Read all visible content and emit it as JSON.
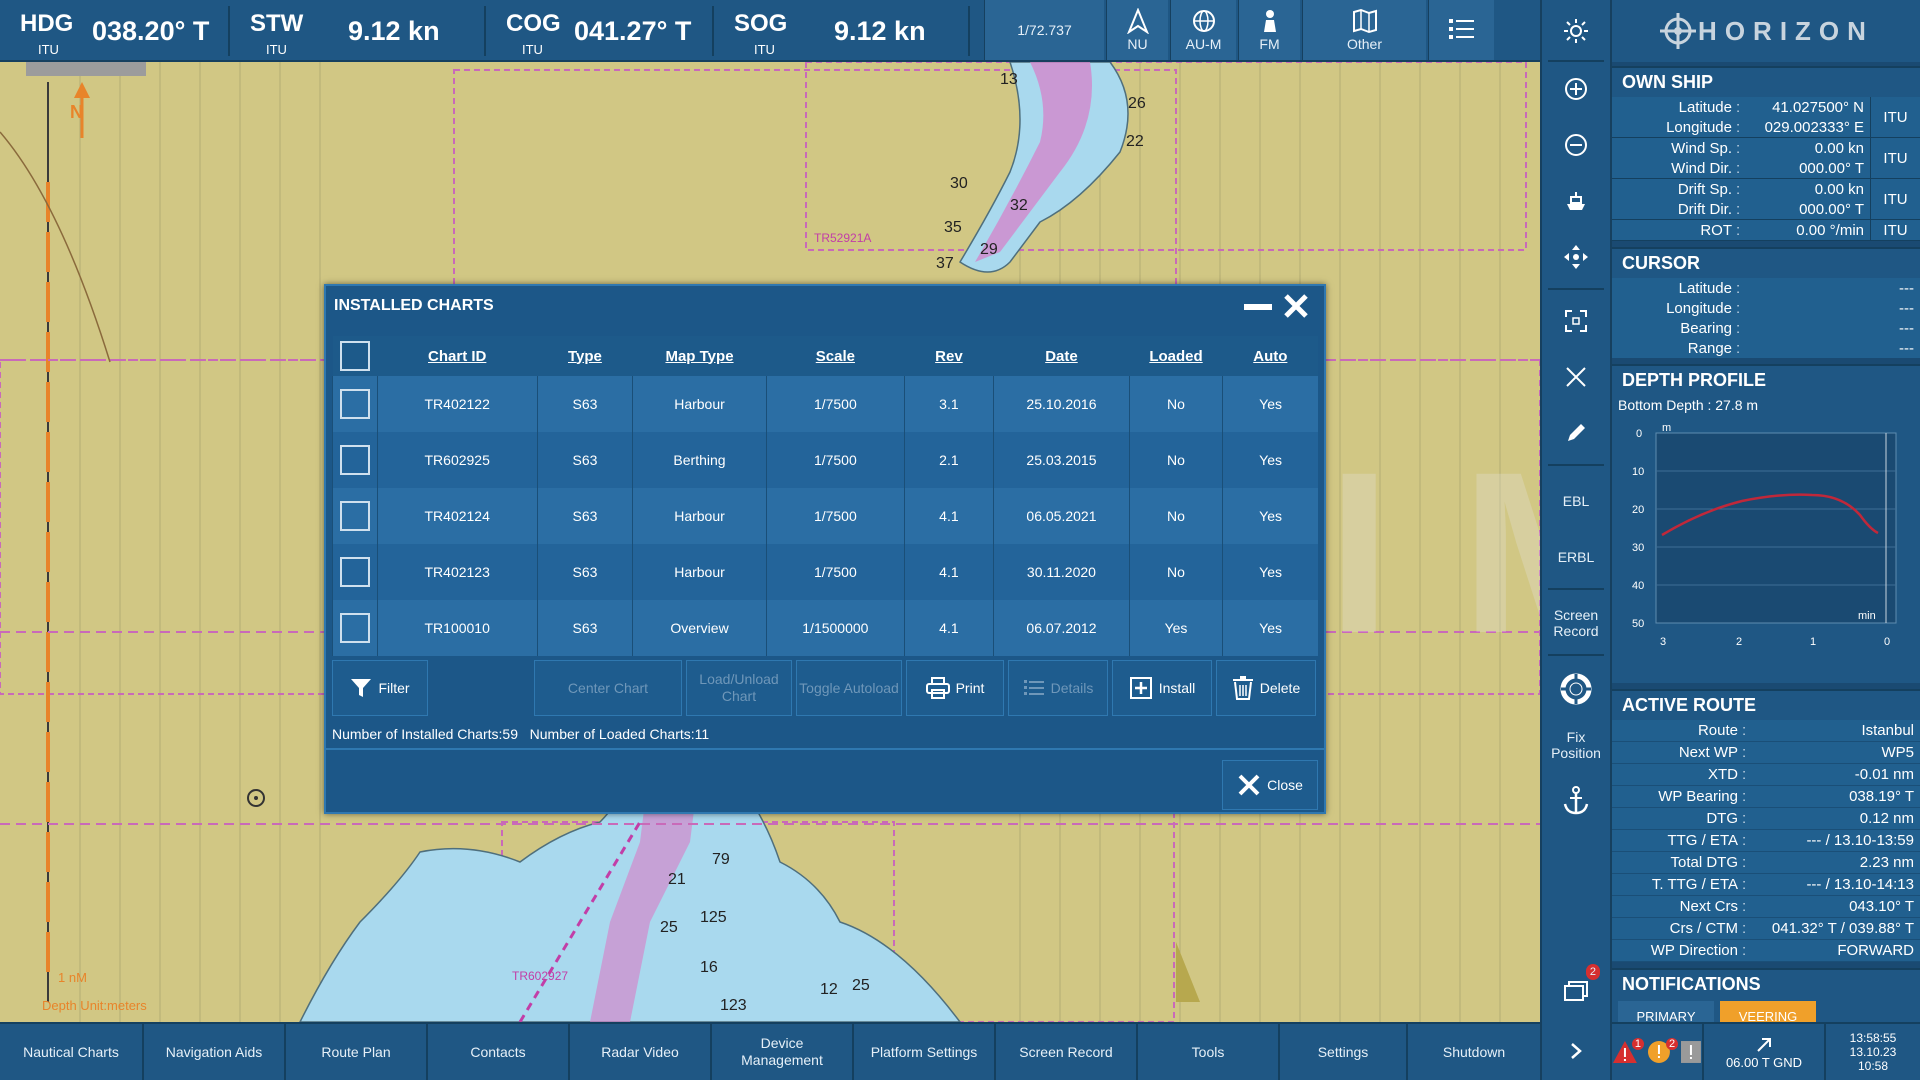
{
  "topbar": {
    "hdg": {
      "label": "HDG",
      "value": "038.20° T",
      "source": "ITU"
    },
    "stw": {
      "label": "STW",
      "value": "9.12 kn",
      "source": "ITU"
    },
    "cog": {
      "label": "COG",
      "value": "041.27° T",
      "source": "ITU"
    },
    "sog": {
      "label": "SOG",
      "value": "9.12 kn",
      "source": "ITU"
    },
    "scale": "1/72.737",
    "nu_label": "NU",
    "aum_label": "AU-M",
    "fm_label": "FM",
    "other_label": "Other"
  },
  "map": {
    "north_label": "N",
    "scale_bar": "1 nM",
    "depth_unit": "Depth Unit:meters",
    "labels": {
      "tr529": "TR52921A",
      "tr602": "TR602927"
    },
    "soundings": [
      "13",
      "26",
      "22",
      "30",
      "32",
      "35",
      "37",
      "29",
      "125",
      "79",
      "25",
      "21",
      "16",
      "25",
      "12",
      "123"
    ]
  },
  "watermark": "MARSIM",
  "tools": {
    "ebl": "EBL",
    "erbl": "ERBL",
    "screen_record": "Screen Record",
    "fix_position": "Fix Position",
    "notif_count": "2"
  },
  "brand": "HORIZON",
  "own_ship": {
    "title": "OWN SHIP",
    "latitude": {
      "label": "Latitude",
      "value": "41.027500° N"
    },
    "longitude": {
      "label": "Longitude",
      "value": "029.002333° E"
    },
    "pos_src": "ITU",
    "wind_sp": {
      "label": "Wind Sp.",
      "value": "0.00 kn"
    },
    "wind_dir": {
      "label": "Wind Dir.",
      "value": "000.00° T"
    },
    "wind_src": "ITU",
    "drift_sp": {
      "label": "Drift Sp.",
      "value": "0.00 kn"
    },
    "drift_dir": {
      "label": "Drift Dir.",
      "value": "000.00° T"
    },
    "drift_src": "ITU",
    "rot": {
      "label": "ROT",
      "value": "0.00 °/min"
    },
    "rot_src": "ITU"
  },
  "cursor": {
    "title": "CURSOR",
    "latitude": {
      "label": "Latitude",
      "value": "---"
    },
    "longitude": {
      "label": "Longitude",
      "value": "---"
    },
    "bearing": {
      "label": "Bearing",
      "value": "---"
    },
    "range": {
      "label": "Range",
      "value": "---"
    }
  },
  "depth_profile": {
    "title": "DEPTH PROFILE",
    "bottom_depth": "Bottom Depth : 27.8 m",
    "unit_y": "m",
    "unit_x": "min",
    "y_ticks": [
      "0",
      "10",
      "20",
      "30",
      "40",
      "50"
    ],
    "x_ticks": [
      "3",
      "2",
      "1",
      "0"
    ]
  },
  "active_route": {
    "title": "ACTIVE ROUTE",
    "rows": [
      {
        "label": "Route",
        "value": "Istanbul"
      },
      {
        "label": "Next WP",
        "value": "WP5"
      },
      {
        "label": "XTD",
        "value": "-0.01 nm"
      },
      {
        "label": "WP Bearing",
        "value": "038.19° T"
      },
      {
        "label": "DTG",
        "value": "0.12 nm"
      },
      {
        "label": "TTG / ETA",
        "value": "--- / 13.10-13:59"
      },
      {
        "label": "Total DTG",
        "value": "2.23 nm"
      },
      {
        "label": "T. TTG / ETA",
        "value": "--- / 13.10-14:13"
      },
      {
        "label": "Next Crs",
        "value": "043.10° T"
      },
      {
        "label": "Crs / CTM",
        "value": "041.32° T / 039.88° T"
      },
      {
        "label": "WP Direction",
        "value": "FORWARD"
      }
    ]
  },
  "notifications": {
    "title": "NOTIFICATIONS",
    "tab_primary": "PRIMARY",
    "tab_veering": "VEERING",
    "alarm_count": "1",
    "warning_count": "2"
  },
  "status": {
    "wind": "06.00 T GND",
    "time": "13:58:55",
    "date": "13.10.23",
    "time2": "10:58"
  },
  "bottom_menu": [
    "Nautical Charts",
    "Navigation Aids",
    "Route Plan",
    "Contacts",
    "Radar Video",
    "Device Management",
    "Platform Settings",
    "Screen Record",
    "Tools",
    "Settings",
    "Shutdown"
  ],
  "dialog": {
    "title": "INSTALLED CHARTS",
    "columns": [
      "Chart ID",
      "Type",
      "Map Type",
      "Scale",
      "Rev",
      "Date",
      "Loaded",
      "Auto"
    ],
    "rows": [
      {
        "chart_id": "TR402122",
        "type": "S63",
        "map_type": "Harbour",
        "scale": "1/7500",
        "rev": "3.1",
        "date": "25.10.2016",
        "loaded": "No",
        "auto": "Yes"
      },
      {
        "chart_id": "TR602925",
        "type": "S63",
        "map_type": "Berthing",
        "scale": "1/7500",
        "rev": "2.1",
        "date": "25.03.2015",
        "loaded": "No",
        "auto": "Yes"
      },
      {
        "chart_id": "TR402124",
        "type": "S63",
        "map_type": "Harbour",
        "scale": "1/7500",
        "rev": "4.1",
        "date": "06.05.2021",
        "loaded": "No",
        "auto": "Yes"
      },
      {
        "chart_id": "TR402123",
        "type": "S63",
        "map_type": "Harbour",
        "scale": "1/7500",
        "rev": "4.1",
        "date": "30.11.2020",
        "loaded": "No",
        "auto": "Yes"
      },
      {
        "chart_id": "TR100010",
        "type": "S63",
        "map_type": "Overview",
        "scale": "1/1500000",
        "rev": "4.1",
        "date": "06.07.2012",
        "loaded": "Yes",
        "auto": "Yes"
      }
    ],
    "buttons": {
      "filter": "Filter",
      "center_chart": "Center Chart",
      "load_unload": "Load/Unload Chart",
      "toggle_autoload": "Toggle Autoload",
      "print": "Print",
      "details": "Details",
      "install": "Install",
      "delete": "Delete",
      "close": "Close"
    },
    "status_installed": "Number of Installed Charts:59",
    "status_loaded": "Number of Loaded Charts:11"
  }
}
